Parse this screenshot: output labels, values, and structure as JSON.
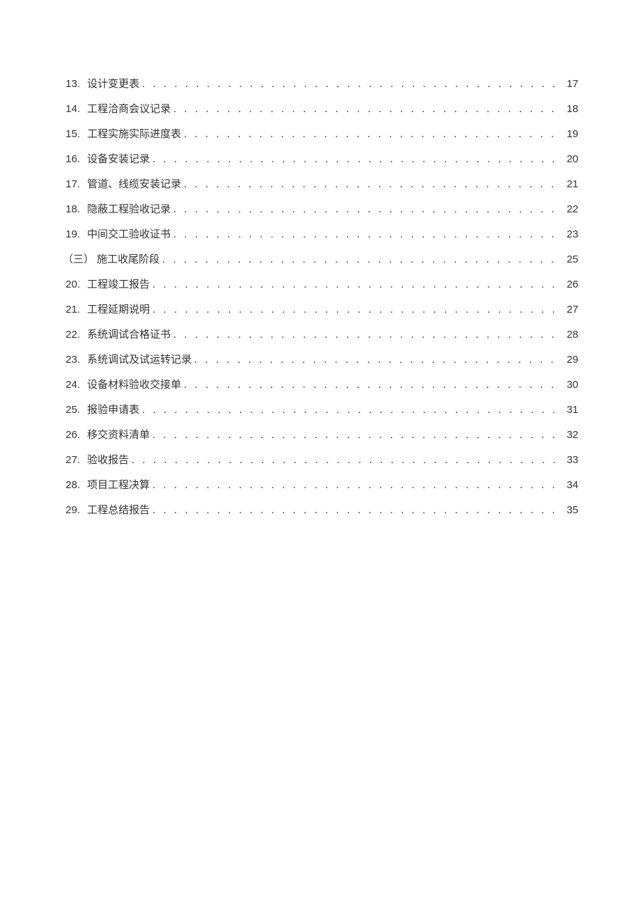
{
  "toc": [
    {
      "num": "13.",
      "title": "设计变更表",
      "page": "17",
      "section": false
    },
    {
      "num": "14.",
      "title": "工程洽商会议记录",
      "page": "18",
      "section": false
    },
    {
      "num": "15.",
      "title": "工程实施实际进度表",
      "page": "19",
      "section": false
    },
    {
      "num": "16.",
      "title": "设备安装记录",
      "page": "20",
      "section": false
    },
    {
      "num": "17.",
      "title": "管道、线缆安装记录",
      "page": "21",
      "section": false
    },
    {
      "num": "18.",
      "title": "隐蔽工程验收记录",
      "page": "22",
      "section": false
    },
    {
      "num": "19.",
      "title": "中间交工验收证书",
      "page": "23",
      "section": false
    },
    {
      "num": "（三）",
      "title": "施工收尾阶段",
      "page": "25",
      "section": true
    },
    {
      "num": "20.",
      "title": "工程竣工报告",
      "page": "26",
      "section": false
    },
    {
      "num": "21.",
      "title": "工程延期说明",
      "page": "27",
      "section": false
    },
    {
      "num": "22.",
      "title": "系统调试合格证书",
      "page": "28",
      "section": false
    },
    {
      "num": "23.",
      "title": "系统调试及试运转记录",
      "page": "29",
      "section": false
    },
    {
      "num": "24.",
      "title": "设备材料验收交接单",
      "page": "30",
      "section": false
    },
    {
      "num": "25.",
      "title": "报验申请表",
      "page": "31",
      "section": false
    },
    {
      "num": "26.",
      "title": "移交资料清单",
      "page": "32",
      "section": false
    },
    {
      "num": "27.",
      "title": "验收报告",
      "page": "33",
      "section": false
    },
    {
      "num": "28.",
      "title": "项目工程决算",
      "page": "34",
      "section": false
    },
    {
      "num": "29.",
      "title": "工程总结报告",
      "page": "35",
      "section": false
    }
  ],
  "dots": ". . . . . . . . . . . . . . . . . . . . . . . . . . . . . . . . . . . . . . . . . . . . . . . . . . . . . . . . . . . . . . . . . . . . . . . . . . . . . . . . . . . . . . . . . . . . . . . . . . . ."
}
